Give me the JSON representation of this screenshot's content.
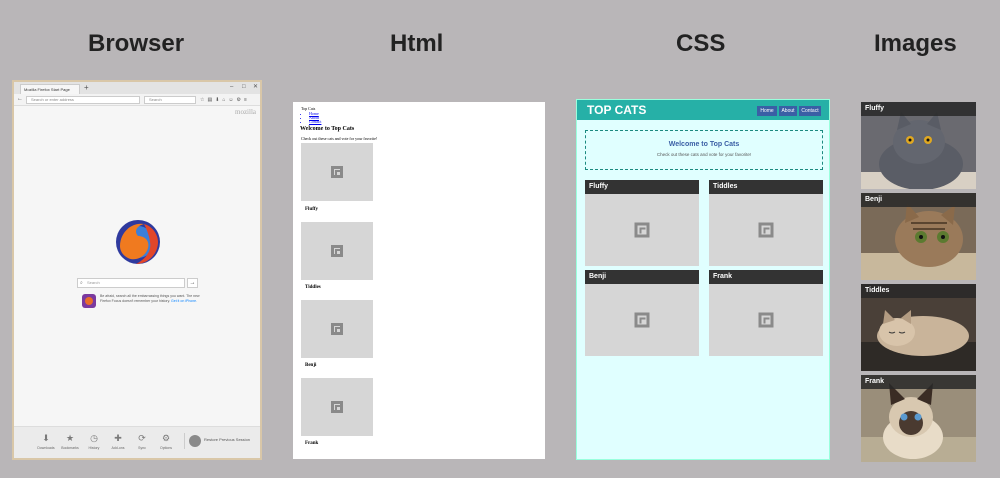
{
  "columns": {
    "browser": "Browser",
    "html": "Html",
    "css": "CSS",
    "images": "Images"
  },
  "browser": {
    "tab_title": "Mozilla Firefox Start Page",
    "url_placeholder": "Search or enter address",
    "search_placeholder": "Search",
    "brand": "mozilla",
    "start_search_placeholder": "Search",
    "promo_text": "Be afraid, search all the embarrassing things you want. The new Firefox Focus doesn't remember your history.",
    "promo_link": "Get it on iPhone.",
    "launcher": [
      "Downloads",
      "Bookmarks",
      "History",
      "Add-ons",
      "Sync",
      "Options"
    ],
    "restore_label": "Restore Previous Session"
  },
  "html_page": {
    "site_title": "Top Cats",
    "links": [
      "Home",
      "About",
      "Contact"
    ],
    "heading": "Welcome to Top Cats",
    "intro": "Check out these cats and vote for your favorite!",
    "cats": [
      "Fluffy",
      "Tiddles",
      "Benji",
      "Frank"
    ]
  },
  "css_page": {
    "title": "TOP CATS",
    "nav": [
      "Home",
      "About",
      "Contact"
    ],
    "welcome_heading": "Welcome to Top Cats",
    "welcome_text": "Check out these cats and vote for your favorite!",
    "cards": [
      "Fluffy",
      "Tiddles",
      "Benji",
      "Frank"
    ],
    "header_color": "#26b0a7",
    "background_color": "#e0ffff"
  },
  "images": {
    "cards": [
      "Fluffy",
      "Benji",
      "Tiddles",
      "Frank"
    ]
  }
}
